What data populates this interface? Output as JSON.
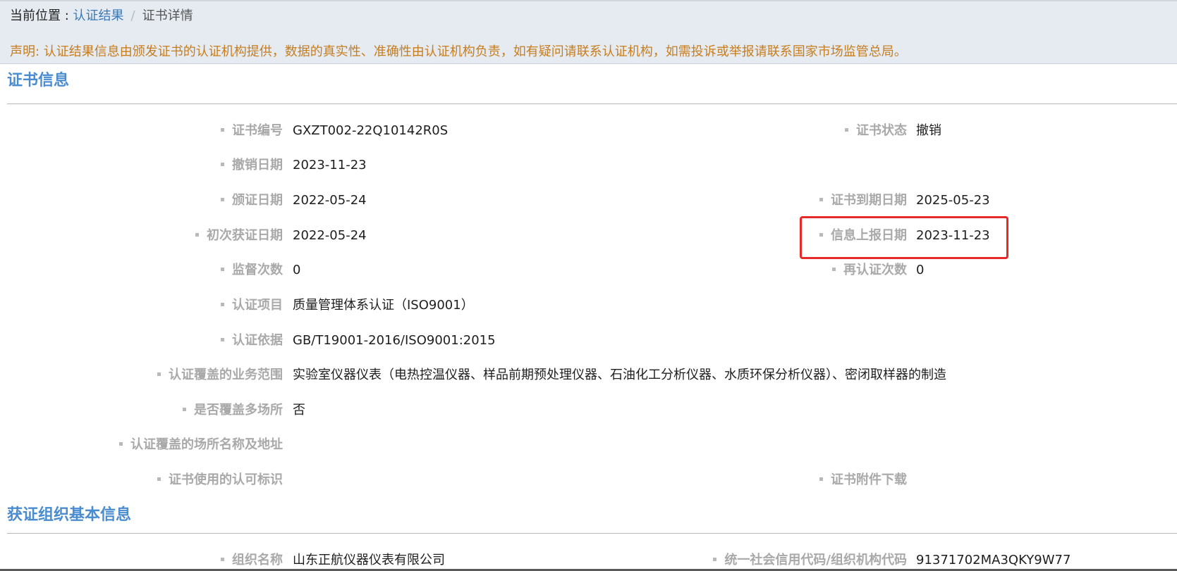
{
  "breadcrumb": {
    "prefix": "当前位置 : ",
    "link": "认证结果",
    "separator": "/",
    "current": "证书详情"
  },
  "notice": "声明: 认证结果信息由颁发证书的认证机构提供，数据的真实性、准确性由认证机构负责，如有疑问请联系认证机构，如需投诉或举报请联系国家市场监管总局。",
  "cert_section": {
    "title": "证书信息",
    "rows": [
      {
        "left": {
          "label": "证书编号",
          "value": "GXZT002-22Q10142R0S"
        },
        "right": {
          "label": "证书状态",
          "value": "撤销"
        }
      },
      {
        "left": {
          "label": "撤销日期",
          "value": "2023-11-23"
        },
        "right": {
          "label": "",
          "value": ""
        }
      },
      {
        "left": {
          "label": "颁证日期",
          "value": "2022-05-24"
        },
        "right": {
          "label": "证书到期日期",
          "value": "2025-05-23"
        }
      },
      {
        "left": {
          "label": "初次获证日期",
          "value": "2022-05-24"
        },
        "right": {
          "label": "信息上报日期",
          "value": "2023-11-23"
        }
      },
      {
        "left": {
          "label": "监督次数",
          "value": "0"
        },
        "right": {
          "label": "再认证次数",
          "value": "0"
        }
      },
      {
        "left": {
          "label": "认证项目",
          "value": "质量管理体系认证（ISO9001）"
        },
        "right": {
          "label": "",
          "value": ""
        }
      },
      {
        "left": {
          "label": "认证依据",
          "value": "GB/T19001-2016/ISO9001:2015"
        },
        "right": {
          "label": "",
          "value": ""
        }
      },
      {
        "left": {
          "label": "认证覆盖的业务范围",
          "value": "实验室仪器仪表（电热控温仪器、样品前期预处理仪器、石油化工分析仪器、水质环保分析仪器）、密闭取样器的制造"
        },
        "right": {
          "label": "",
          "value": ""
        }
      },
      {
        "left": {
          "label": "是否覆盖多场所",
          "value": "否"
        },
        "right": {
          "label": "",
          "value": ""
        }
      },
      {
        "left": {
          "label": "认证覆盖的场所名称及地址",
          "value": ""
        },
        "right": {
          "label": "",
          "value": ""
        }
      },
      {
        "left": {
          "label": "证书使用的认可标识",
          "value": ""
        },
        "right": {
          "label": "证书附件下载",
          "value": ""
        }
      }
    ]
  },
  "org_section": {
    "title": "获证组织基本信息",
    "rows": [
      {
        "left": {
          "label": "组织名称",
          "value": "山东正航仪器仪表有限公司"
        },
        "right": {
          "label": "统一社会信用代码/组织机构代码",
          "value": "91371702MA3QKY9W77"
        }
      }
    ]
  },
  "colors": {
    "accent": "#4a8cd0",
    "notice": "#c77d1e",
    "label": "#a9a9a9",
    "highlight": "#e62a2a",
    "topbar": "#e5ebf0"
  }
}
